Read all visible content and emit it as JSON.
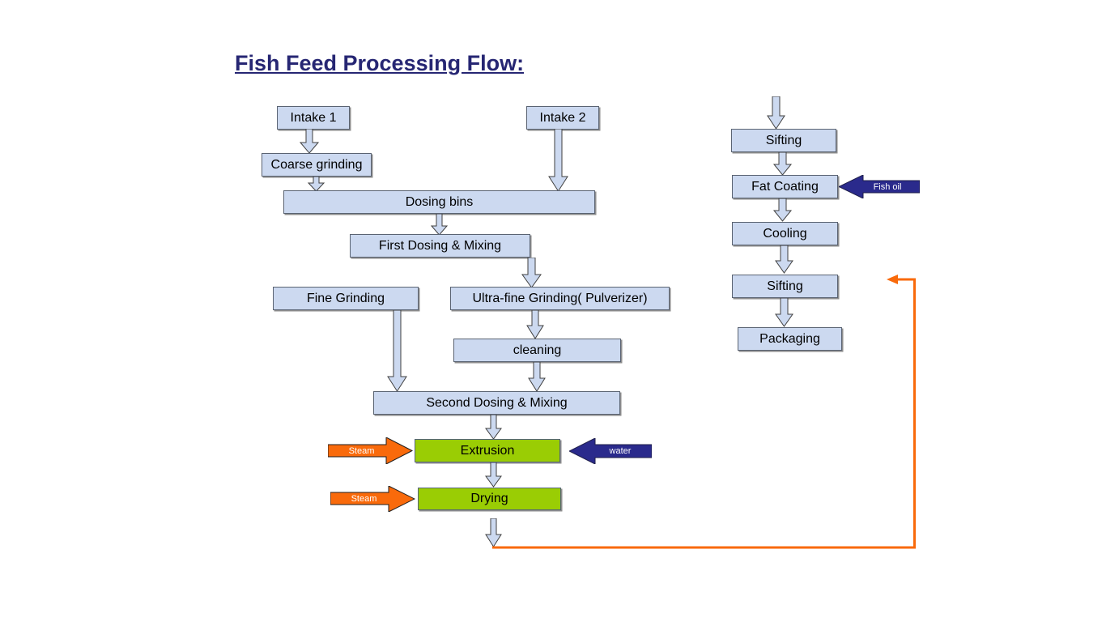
{
  "title": "Fish Feed Processing Flow:",
  "colors": {
    "title": "#262673",
    "box_fill": "#ccd9f0",
    "box_border": "#5a6372",
    "green_fill": "#9acd04",
    "steam_arrow": "#f96a0b",
    "water_arrow": "#2a2a8c",
    "fishoil_arrow": "#2a2a8c",
    "recycle_line": "#f96a0b",
    "arrow_fill": "#ccd9f0",
    "arrow_stroke": "#3f3f3f"
  },
  "flow": {
    "left_column": [
      {
        "id": "intake-1",
        "label": "Intake 1"
      },
      {
        "id": "coarse-grinding",
        "label": "Coarse grinding"
      },
      {
        "id": "intake-2",
        "label": "Intake 2"
      },
      {
        "id": "dosing-bins",
        "label": "Dosing bins"
      },
      {
        "id": "first-dosing-mixing",
        "label": "First Dosing & Mixing"
      },
      {
        "id": "fine-grinding",
        "label": "Fine Grinding"
      },
      {
        "id": "ultra-fine-grinding",
        "label": "Ultra-fine Grinding( Pulverizer)"
      },
      {
        "id": "cleaning",
        "label": "cleaning"
      },
      {
        "id": "second-dosing-mixing",
        "label": "Second Dosing & Mixing"
      },
      {
        "id": "extrusion",
        "label": "Extrusion"
      },
      {
        "id": "drying",
        "label": "Drying"
      }
    ],
    "right_column": [
      {
        "id": "sifting-1",
        "label": "Sifting"
      },
      {
        "id": "fat-coating",
        "label": "Fat Coating"
      },
      {
        "id": "cooling",
        "label": "Cooling"
      },
      {
        "id": "sifting-2",
        "label": "Sifting"
      },
      {
        "id": "packaging",
        "label": "Packaging"
      }
    ],
    "inputs": [
      {
        "id": "steam-extrusion",
        "label": "Steam",
        "target": "Extrusion",
        "direction": "right"
      },
      {
        "id": "steam-drying",
        "label": "Steam",
        "target": "Drying",
        "direction": "right"
      },
      {
        "id": "water-extrusion",
        "label": "water",
        "target": "Extrusion",
        "direction": "left"
      },
      {
        "id": "fish-oil-fat-coating",
        "label": "Fish oil",
        "target": "Fat Coating",
        "direction": "left"
      }
    ]
  }
}
